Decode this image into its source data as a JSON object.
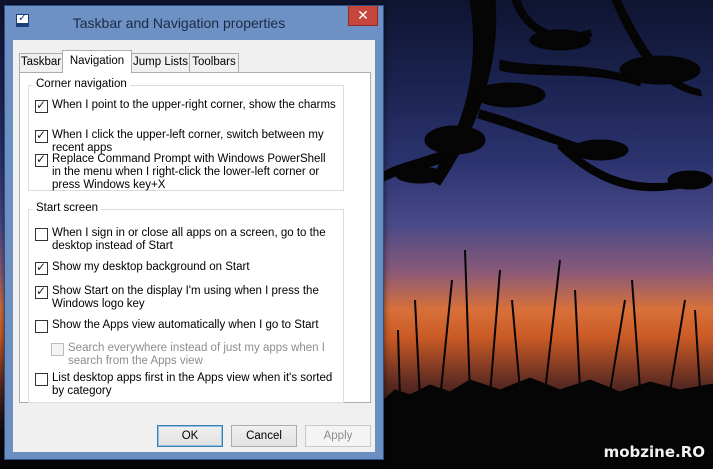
{
  "window": {
    "title": "Taskbar and Navigation properties",
    "close_label": "✕"
  },
  "tabs": [
    {
      "label": "Taskbar",
      "active": false
    },
    {
      "label": "Navigation",
      "active": true
    },
    {
      "label": "Jump Lists",
      "active": false
    },
    {
      "label": "Toolbars",
      "active": false
    }
  ],
  "corner_navigation": {
    "legend": "Corner navigation",
    "options": [
      {
        "label": "When I point to the upper-right corner, show the charms",
        "checked": true,
        "disabled": false
      },
      {
        "label": "When I click the upper-left corner, switch between my recent apps",
        "checked": true,
        "disabled": false
      },
      {
        "label": "Replace Command Prompt with Windows PowerShell in the menu when I right-click the lower-left corner or press Windows key+X",
        "checked": true,
        "disabled": false
      }
    ]
  },
  "start_screen": {
    "legend": "Start screen",
    "options": [
      {
        "label": "When I sign in or close all apps on a screen, go to the desktop instead of Start",
        "checked": false,
        "disabled": false
      },
      {
        "label": "Show my desktop background on Start",
        "checked": true,
        "disabled": false
      },
      {
        "label": "Show Start on the display I'm using when I press the Windows logo key",
        "checked": true,
        "disabled": false
      },
      {
        "label": "Show the Apps view automatically when I go to Start",
        "checked": false,
        "disabled": false
      },
      {
        "label": "Search everywhere instead of just my apps when I search from the Apps view",
        "checked": false,
        "disabled": true
      },
      {
        "label": "List desktop apps first in the Apps view when it's sorted by category",
        "checked": false,
        "disabled": false
      }
    ]
  },
  "buttons": {
    "ok": "OK",
    "cancel": "Cancel",
    "apply": "Apply"
  },
  "watermark": "mobzine.RO"
}
